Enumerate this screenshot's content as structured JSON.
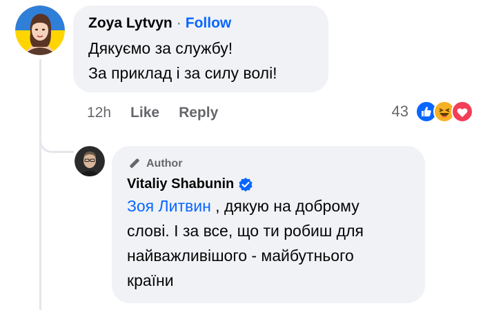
{
  "comment": {
    "author": "Zoya Lytvyn",
    "separator": "·",
    "follow_label": "Follow",
    "lines": [
      "Дякуємо за службу!",
      "За приклад і за силу волі!"
    ],
    "time": "12h",
    "like_label": "Like",
    "reply_label": "Reply",
    "reaction_count": "43",
    "reactions": [
      "like-icon",
      "haha-icon",
      "love-icon"
    ]
  },
  "reply": {
    "badge_label": "Author",
    "author": "Vitaliy Shabunin",
    "verified": true,
    "mention": "Зоя Литвин",
    "line1_rest": " , дякую на доброму",
    "line2": "слові. І за все, що ти робиш для",
    "line3": "найважливішого - майбутнього",
    "line4": "країни"
  },
  "colors": {
    "accent": "#0866ff",
    "bubble": "#f0f2f5",
    "secondary_text": "#65676b",
    "love": "#f33e58",
    "haha": "#f7b125"
  }
}
